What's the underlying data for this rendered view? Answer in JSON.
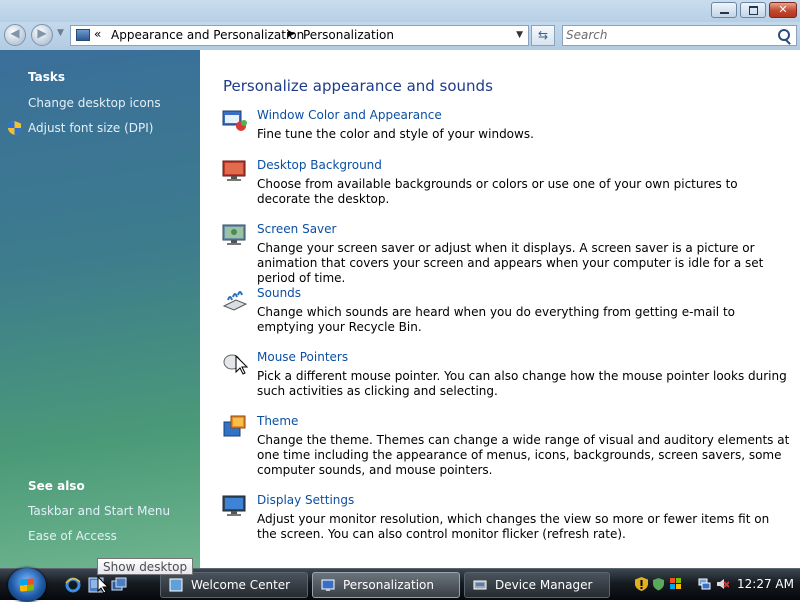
{
  "address_bar": {
    "chevron": "«",
    "crumbs": [
      "Appearance and Personalization",
      "Personalization"
    ]
  },
  "search": {
    "placeholder": "Search"
  },
  "left_pane": {
    "tasks_heading": "Tasks",
    "tasks": [
      "Change desktop icons",
      "Adjust font size (DPI)"
    ],
    "see_also_heading": "See also",
    "see_also": [
      "Taskbar and Start Menu",
      "Ease of Access"
    ]
  },
  "main": {
    "title": "Personalize appearance and sounds",
    "items": [
      {
        "label": "Window Color and Appearance",
        "description": "Fine tune the color and style of your windows.",
        "icon": "window-color-icon"
      },
      {
        "label": "Desktop Background",
        "description": "Choose from available backgrounds or colors or use one of your own pictures to decorate the desktop.",
        "icon": "desktop-background-icon"
      },
      {
        "label": "Screen Saver",
        "description": "Change your screen saver or adjust when it displays. A screen saver is a picture or animation that covers your screen and appears when your computer is idle for a set period of time.",
        "icon": "screen-saver-icon"
      },
      {
        "label": "Sounds",
        "description": "Change which sounds are heard when you do everything from getting e-mail to emptying your Recycle Bin.",
        "icon": "sounds-icon"
      },
      {
        "label": "Mouse Pointers",
        "description": "Pick a different mouse pointer. You can also change how the mouse pointer looks during such activities as clicking and selecting.",
        "icon": "mouse-pointers-icon"
      },
      {
        "label": "Theme",
        "description": "Change the theme. Themes can change a wide range of visual and auditory elements at one time including the appearance of menus, icons, backgrounds, screen savers, some computer sounds, and mouse pointers.",
        "icon": "theme-icon"
      },
      {
        "label": "Display Settings",
        "description": "Adjust your monitor resolution, which changes the view so more or fewer items fit on the screen. You can also control monitor flicker (refresh rate).",
        "icon": "display-settings-icon"
      }
    ]
  },
  "taskbar": {
    "buttons": [
      "Welcome Center",
      "Personalization",
      "Device Manager"
    ],
    "active_button": "Personalization",
    "clock": "12:27 AM",
    "tooltip": "Show desktop"
  },
  "colors": {
    "link": "#0c4fa2",
    "title": "#1e3c8a",
    "left_pane_top": "#3a6f9a",
    "left_pane_bottom": "#6fb58f"
  }
}
